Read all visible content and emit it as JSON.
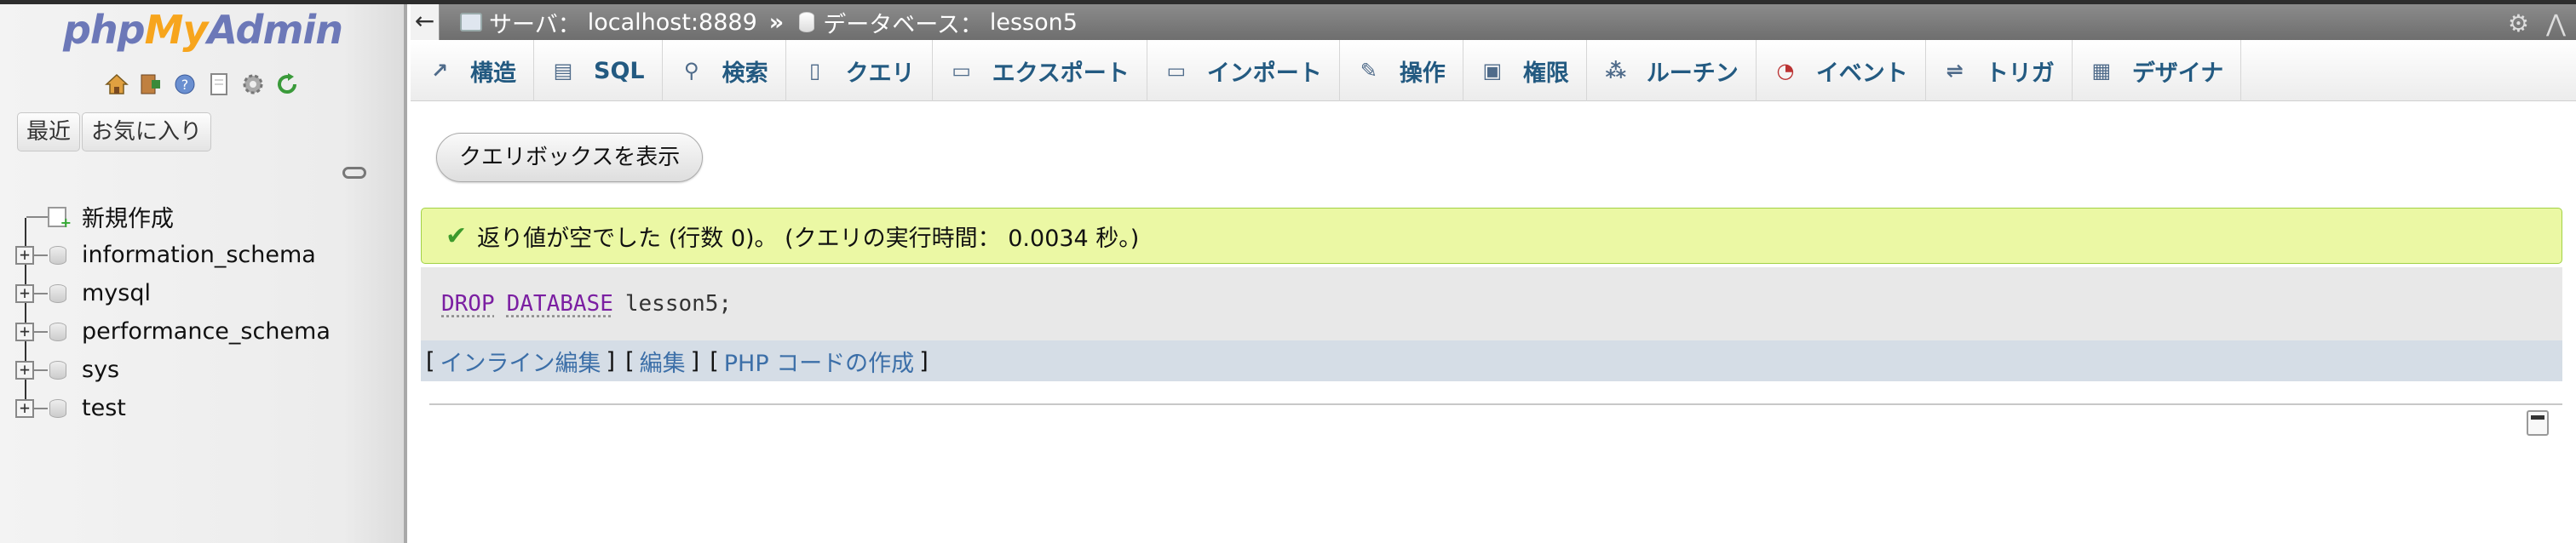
{
  "app": {
    "logo_parts": {
      "php": "php",
      "my": "My",
      "admin": "Admin"
    }
  },
  "nav": {
    "icons": [
      "home-icon",
      "exit-icon",
      "help-icon",
      "docs-icon",
      "gear-icon",
      "reload-icon"
    ],
    "tabs": {
      "recent": "最近",
      "favorites": "お気に入り"
    },
    "tree": [
      {
        "label": "新規作成",
        "type": "new"
      },
      {
        "label": "information_schema",
        "type": "db"
      },
      {
        "label": "mysql",
        "type": "db"
      },
      {
        "label": "performance_schema",
        "type": "db"
      },
      {
        "label": "sys",
        "type": "db"
      },
      {
        "label": "test",
        "type": "db"
      }
    ]
  },
  "breadcrumb": {
    "collapse": "←",
    "server_label": "サーバ：",
    "server_value": "localhost:8889",
    "separator": "»",
    "db_label": "データベース：",
    "db_value": "lesson5"
  },
  "tabs": [
    {
      "label": "構造",
      "icon": "structure-icon"
    },
    {
      "label": "SQL",
      "icon": "sql-icon"
    },
    {
      "label": "検索",
      "icon": "search-icon"
    },
    {
      "label": "クエリ",
      "icon": "query-icon"
    },
    {
      "label": "エクスポート",
      "icon": "export-icon"
    },
    {
      "label": "インポート",
      "icon": "import-icon"
    },
    {
      "label": "操作",
      "icon": "operations-icon"
    },
    {
      "label": "権限",
      "icon": "privileges-icon"
    },
    {
      "label": "ルーチン",
      "icon": "routines-icon"
    },
    {
      "label": "イベント",
      "icon": "events-icon"
    },
    {
      "label": "トリガ",
      "icon": "triggers-icon"
    },
    {
      "label": "デザイナ",
      "icon": "designer-icon"
    }
  ],
  "content": {
    "show_query_button": "クエリボックスを表示",
    "success_message": "返り値が空でした (行数 0)。 (クエリの実行時間： 0.0034 秒。)",
    "sql": {
      "kw1": "DROP",
      "kw2": "DATABASE",
      "rest": "lesson5;"
    },
    "links": {
      "open": "[",
      "close": "]",
      "inline_edit": "インライン編集",
      "edit": "編集",
      "php_code": "PHP コードの作成"
    }
  },
  "colors": {
    "success_bg": "#ebf8a4",
    "success_border": "#a2d246",
    "link": "#3c6fa8",
    "keyword": "#7b1fa2",
    "tab_text": "#235a81"
  }
}
